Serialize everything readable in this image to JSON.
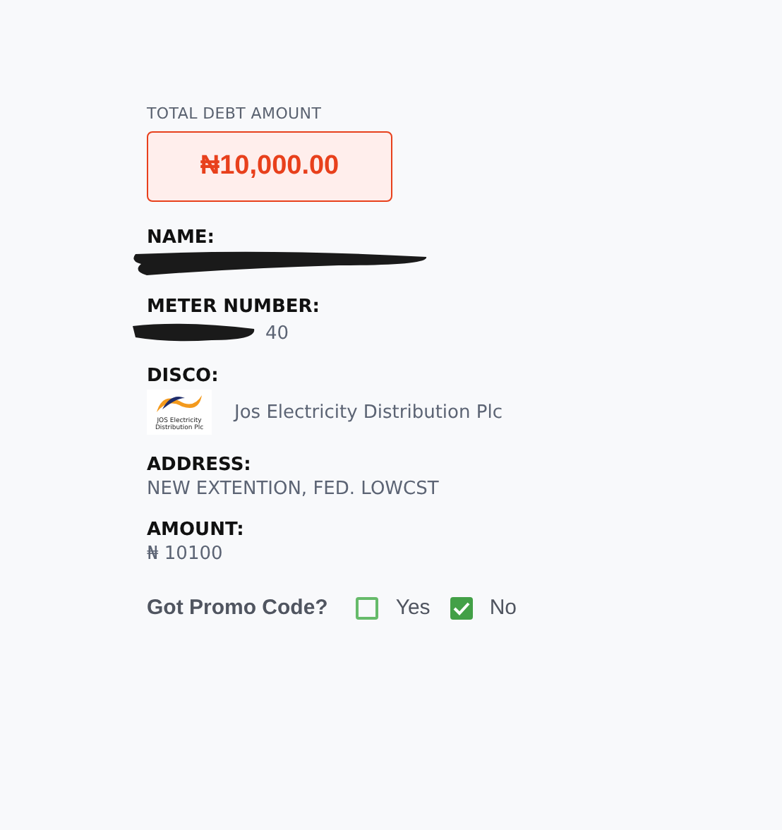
{
  "debt": {
    "label": "TOTAL DEBT AMOUNT",
    "value": "₦10,000.00"
  },
  "fields": [
    {
      "kind": "redacted",
      "label": "NAME:"
    },
    {
      "kind": "redacted",
      "label": "METER NUMBER:",
      "value": "40"
    },
    {
      "kind": "logo",
      "label": "DISCO:",
      "value": "Jos Electricity Distribution Plc",
      "logo_text": [
        "JOS Electricity",
        "Distribution Plc"
      ]
    },
    {
      "kind": "text",
      "label": "ADDRESS:",
      "value": "NEW EXTENTION, FED. LOWCST"
    },
    {
      "kind": "text",
      "label": "AMOUNT:",
      "value": "₦ 10100"
    }
  ],
  "promo": {
    "label": "Got Promo Code?",
    "options": [
      {
        "label": "Yes",
        "checked": false
      },
      {
        "label": "No",
        "checked": true
      }
    ]
  }
}
